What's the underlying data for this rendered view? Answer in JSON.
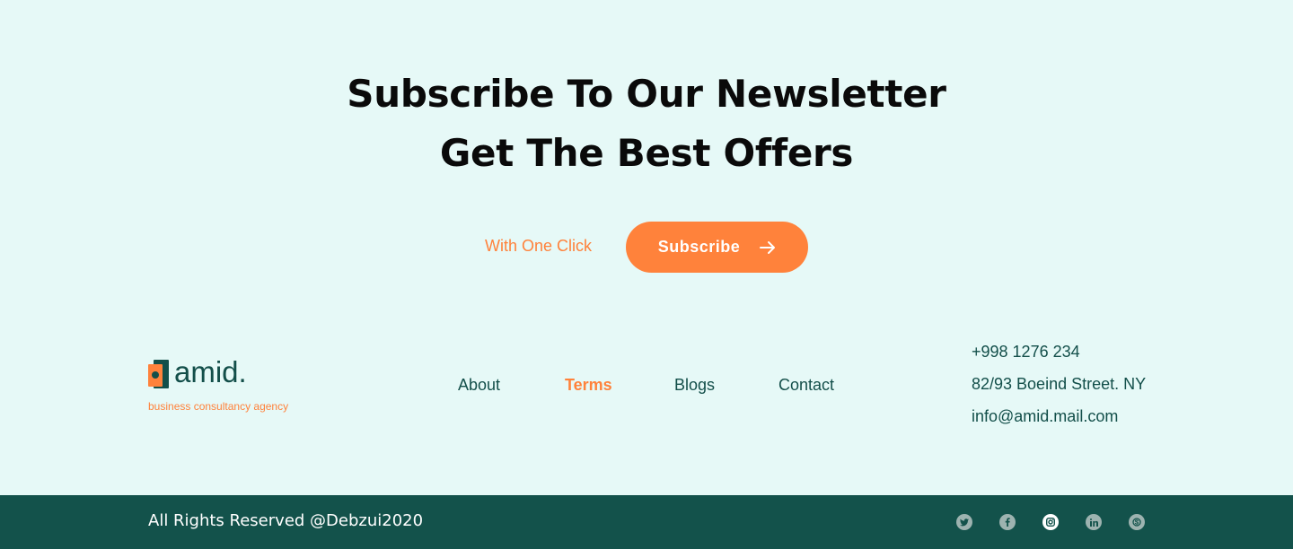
{
  "newsletter": {
    "title_line1": "Subscribe To Our Newsletter",
    "title_line2": "Get The Best Offers",
    "cta_text": "With One Click",
    "button_label": "Subscribe"
  },
  "brand": {
    "name": "amid.",
    "tagline": "business consultancy agency",
    "colors": {
      "accent": "#ff823b",
      "primary": "#134f4a",
      "background": "#e6f9f7",
      "footer_bar": "#13524b"
    }
  },
  "footer_nav": {
    "items": [
      {
        "label": "About",
        "active": false
      },
      {
        "label": "Terms",
        "active": true
      },
      {
        "label": "Blogs",
        "active": false
      },
      {
        "label": "Contact",
        "active": false
      }
    ]
  },
  "contact": {
    "phone": "+998 1276 234",
    "address": "82/93 Boeind Street. NY",
    "email": "info@amid.mail.com"
  },
  "bottom_bar": {
    "copyright": "All Rights Reserved @Debzui2020",
    "social": [
      {
        "icon": "twitter-icon",
        "active": false
      },
      {
        "icon": "facebook-icon",
        "active": false
      },
      {
        "icon": "instagram-icon",
        "active": true
      },
      {
        "icon": "linkedin-icon",
        "active": false
      },
      {
        "icon": "skype-icon",
        "active": false
      }
    ]
  }
}
